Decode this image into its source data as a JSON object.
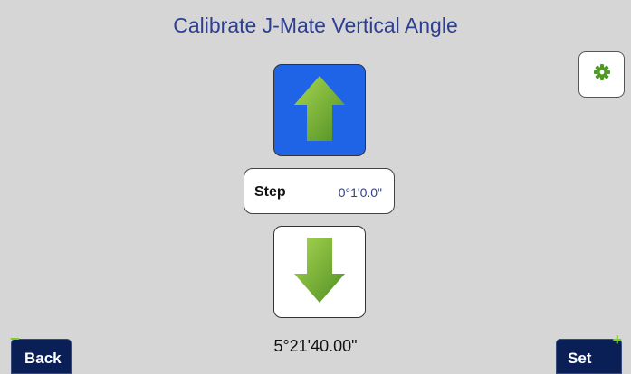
{
  "header": {
    "title": "Calibrate J-Mate Vertical Angle"
  },
  "controls": {
    "up_icon": "arrow-up-icon",
    "down_icon": "arrow-down-icon",
    "step_label": "Step",
    "step_value": "0°1'0.0\"",
    "current_angle": "5°21'40.00\""
  },
  "settings": {
    "icon": "gear-icon"
  },
  "footer": {
    "back_label": "Back",
    "back_sign": "−",
    "set_label": "Set",
    "set_sign": "+"
  },
  "colors": {
    "background": "#d6d6d6",
    "title": "#2d3f92",
    "up_button": "#1f63e6",
    "arrow_green_light": "#9ccf4a",
    "arrow_green_dark": "#5f9c2a",
    "footer_button": "#0b1f57",
    "accent_green": "#7ad01e"
  }
}
